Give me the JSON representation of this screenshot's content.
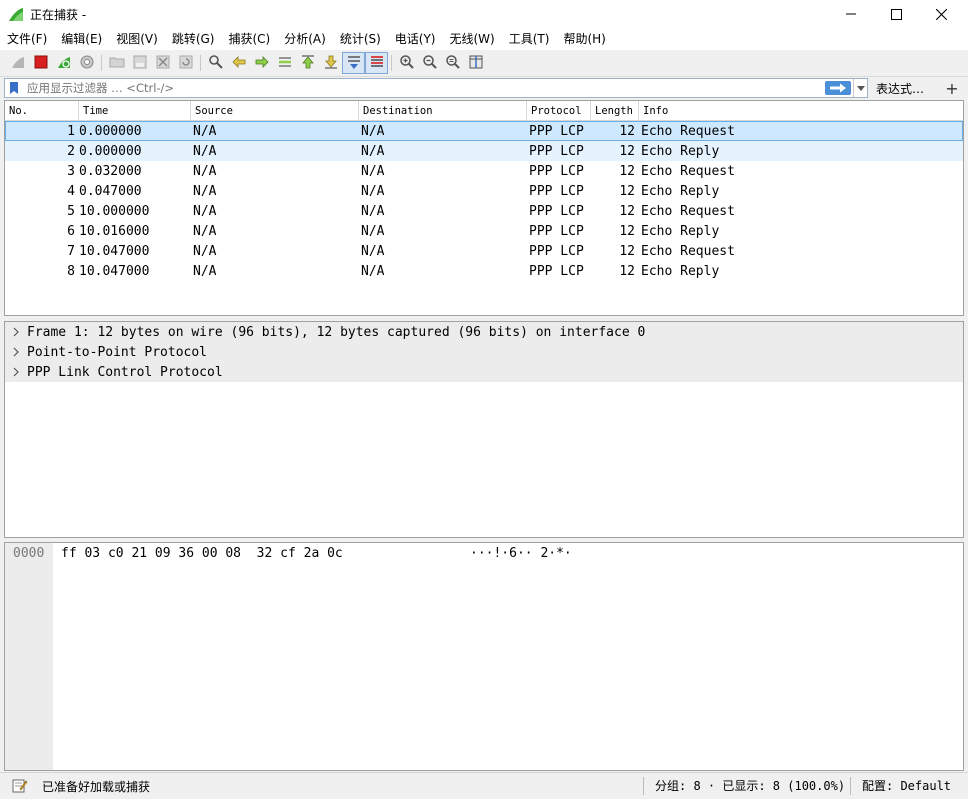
{
  "window": {
    "title": "正在捕获 -"
  },
  "menu": [
    {
      "label": "文件(F)"
    },
    {
      "label": "编辑(E)"
    },
    {
      "label": "视图(V)"
    },
    {
      "label": "跳转(G)"
    },
    {
      "label": "捕获(C)"
    },
    {
      "label": "分析(A)"
    },
    {
      "label": "统计(S)"
    },
    {
      "label": "电话(Y)"
    },
    {
      "label": "无线(W)"
    },
    {
      "label": "工具(T)"
    },
    {
      "label": "帮助(H)"
    }
  ],
  "filter": {
    "placeholder": "应用显示过滤器 … <Ctrl-/>",
    "expression_label": "表达式…",
    "add_label": "+"
  },
  "packet_list": {
    "columns": [
      "No.",
      "Time",
      "Source",
      "Destination",
      "Protocol",
      "Length",
      "Info"
    ],
    "rows": [
      {
        "no": "1",
        "time": "0.000000",
        "source": "N/A",
        "destination": "N/A",
        "protocol": "PPP LCP",
        "length": "12",
        "info": "Echo Request"
      },
      {
        "no": "2",
        "time": "0.000000",
        "source": "N/A",
        "destination": "N/A",
        "protocol": "PPP LCP",
        "length": "12",
        "info": "Echo Reply"
      },
      {
        "no": "3",
        "time": "0.032000",
        "source": "N/A",
        "destination": "N/A",
        "protocol": "PPP LCP",
        "length": "12",
        "info": "Echo Request"
      },
      {
        "no": "4",
        "time": "0.047000",
        "source": "N/A",
        "destination": "N/A",
        "protocol": "PPP LCP",
        "length": "12",
        "info": "Echo Reply"
      },
      {
        "no": "5",
        "time": "10.000000",
        "source": "N/A",
        "destination": "N/A",
        "protocol": "PPP LCP",
        "length": "12",
        "info": "Echo Request"
      },
      {
        "no": "6",
        "time": "10.016000",
        "source": "N/A",
        "destination": "N/A",
        "protocol": "PPP LCP",
        "length": "12",
        "info": "Echo Reply"
      },
      {
        "no": "7",
        "time": "10.047000",
        "source": "N/A",
        "destination": "N/A",
        "protocol": "PPP LCP",
        "length": "12",
        "info": "Echo Request"
      },
      {
        "no": "8",
        "time": "10.047000",
        "source": "N/A",
        "destination": "N/A",
        "protocol": "PPP LCP",
        "length": "12",
        "info": "Echo Reply"
      }
    ]
  },
  "details": [
    {
      "label": "Frame 1: 12 bytes on wire (96 bits), 12 bytes captured (96 bits) on interface 0"
    },
    {
      "label": "Point-to-Point Protocol"
    },
    {
      "label": "PPP Link Control Protocol"
    }
  ],
  "bytes": {
    "offset": "0000",
    "hex": "ff 03 c0 21 09 36 00 08  32 cf 2a 0c",
    "ascii": "···!·6·· 2·*·"
  },
  "status": {
    "ready_text": "已准备好加载或捕获",
    "packets_text": "分组: 8 · 已显示: 8 (100.0%)",
    "profile_text": "配置: Default"
  },
  "colors": {
    "selected_row": "#cde8ff",
    "hover_row": "#e5f3ff",
    "detail_row": "#ececec",
    "capture_stop": "#d81e1e",
    "shark_fin": "#3aaa35"
  }
}
